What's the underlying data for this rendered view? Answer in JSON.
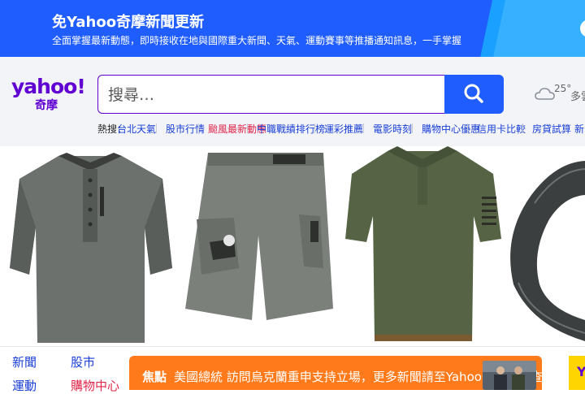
{
  "banner": {
    "title": "免Yahoo奇摩新聞更新",
    "subtitle": "全面掌握最新動態，即時接收在地與國際重大新聞、天氣、運動賽事等推播通知訊息，一手掌握"
  },
  "logo": {
    "word": "yahoo!",
    "chinese": "奇摩"
  },
  "search": {
    "placeholder": "搜尋…",
    "button_icon": "search-icon"
  },
  "weather": {
    "icon": "cloud-icon",
    "temp": "25°",
    "condition": "多雲"
  },
  "nav": {
    "prefix": "熱搜：",
    "items": [
      {
        "label": "台北天氣"
      },
      {
        "label": "股市行情"
      },
      {
        "label": "颱風最新動態",
        "hot": true
      },
      {
        "label": "中職戰績排行榜"
      },
      {
        "label": "運彩推薦"
      },
      {
        "label": "電影時刻"
      },
      {
        "label": "購物中心優惠"
      },
      {
        "label": "信用卡比較"
      },
      {
        "label": "房貸試算"
      },
      {
        "label": "新聞"
      }
    ]
  },
  "ads": [
    {
      "name": "henley-tshirt"
    },
    {
      "name": "cargo-shorts"
    },
    {
      "name": "polo-shirt"
    },
    {
      "name": "tactical-belt"
    }
  ],
  "bottom_links": [
    {
      "label": "新聞",
      "hot": false
    },
    {
      "label": "股市",
      "hot": false
    },
    {
      "label": "運動",
      "hot": false
    },
    {
      "label": "購物中心",
      "hot": true
    }
  ],
  "news": {
    "tag": "焦點",
    "headline": "美國總統 訪問烏克蘭重申支持立場，更多新聞請至Yahoo奇摩新聞查看"
  },
  "badge": {
    "label": "Y"
  },
  "colors": {
    "brand": "#6001d2",
    "accent": "#1f5dff",
    "hot": "#e0254a",
    "news": "#ff7a1a"
  }
}
